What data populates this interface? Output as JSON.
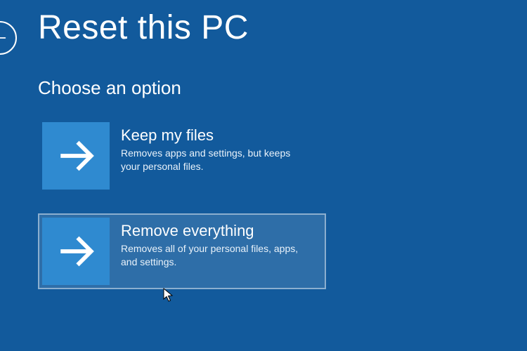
{
  "header": {
    "title": "Reset this PC",
    "subtitle": "Choose an option"
  },
  "options": [
    {
      "title": "Keep my files",
      "desc": "Removes apps and settings, but keeps your personal files.",
      "icon": "arrow-right-icon",
      "hover": false
    },
    {
      "title": "Remove everything",
      "desc": "Removes all of your personal files, apps, and settings.",
      "icon": "arrow-right-icon",
      "hover": true
    }
  ],
  "colors": {
    "background": "#125a9c",
    "tile": "#2f8ad0",
    "text": "#ffffff"
  }
}
